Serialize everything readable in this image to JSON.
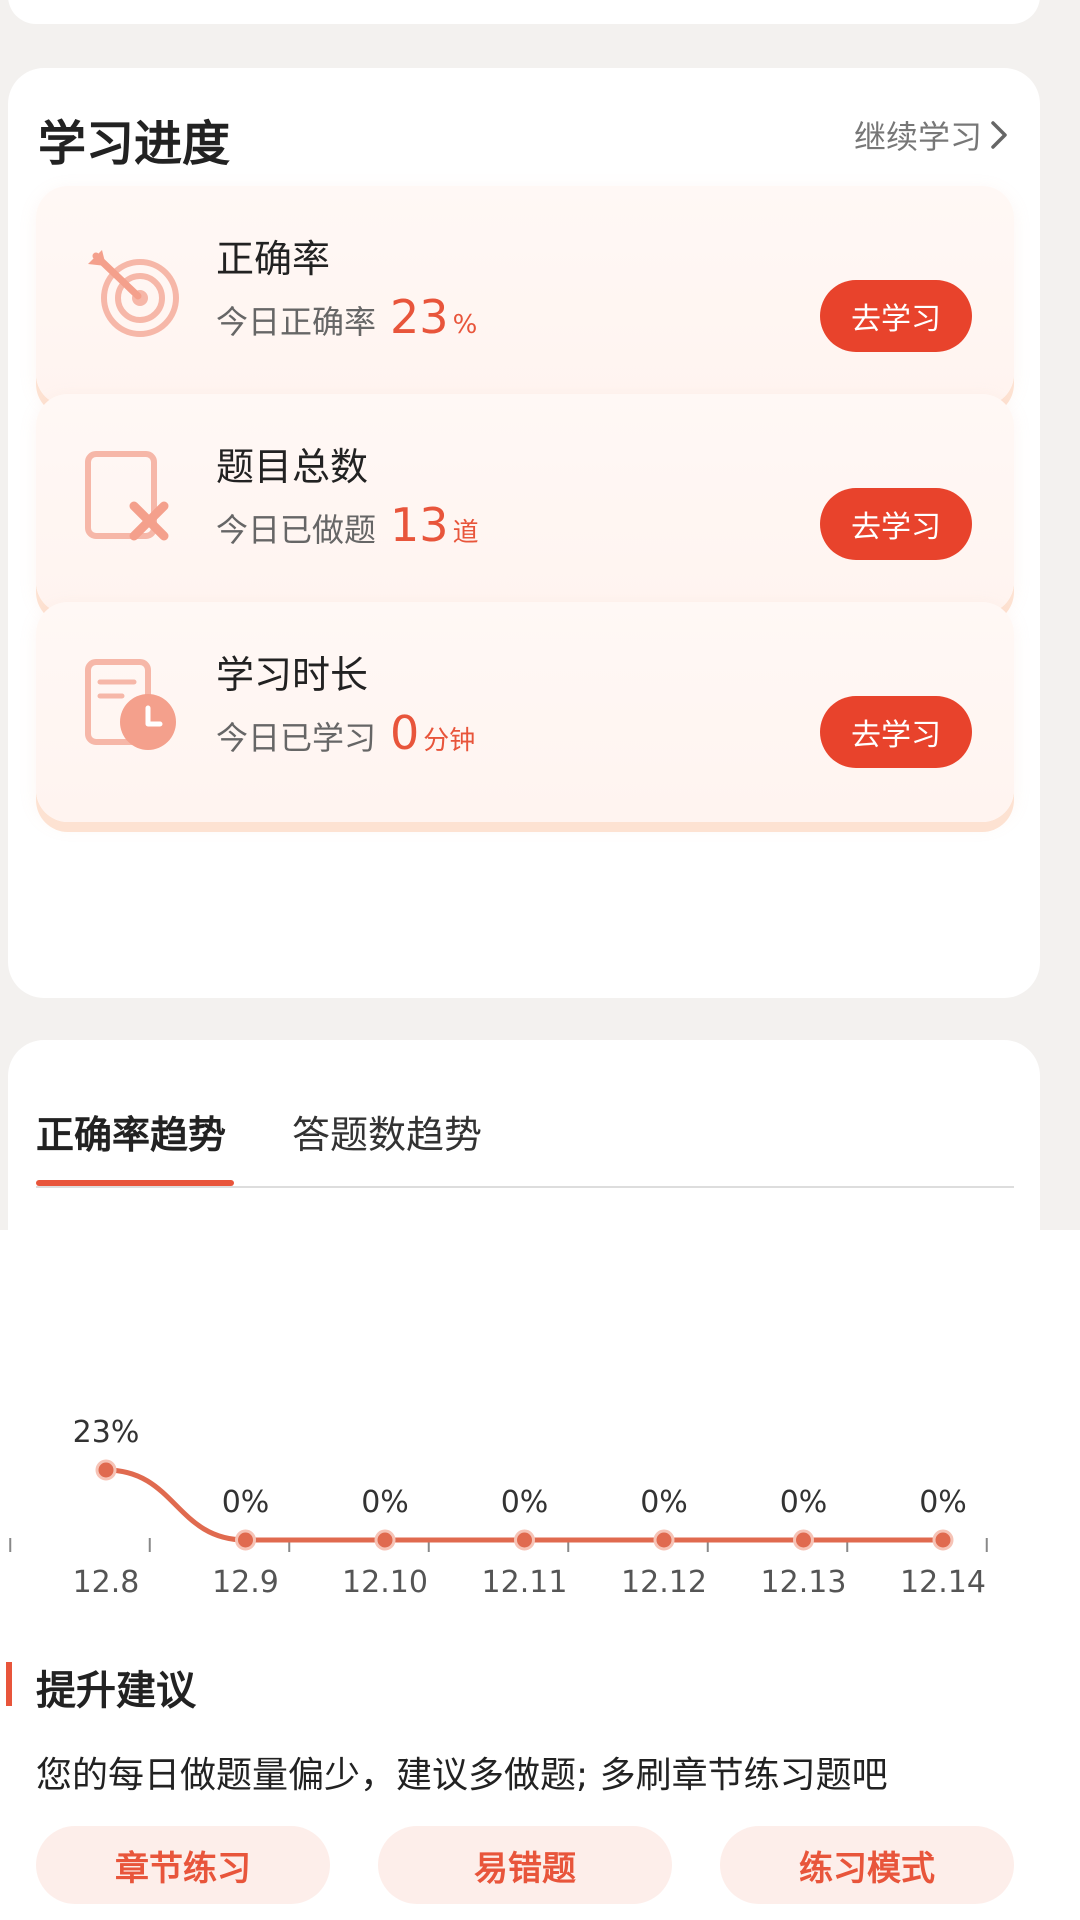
{
  "progress": {
    "title": "学习进度",
    "continue_label": "继续学习",
    "items": [
      {
        "title": "正确率",
        "sub_label": "今日正确率",
        "value": "23",
        "unit": "%",
        "button": "去学习",
        "icon": "target-icon"
      },
      {
        "title": "题目总数",
        "sub_label": "今日已做题",
        "value": "13",
        "unit": "道",
        "button": "去学习",
        "icon": "question-paper-icon"
      },
      {
        "title": "学习时长",
        "sub_label": "今日已学习",
        "value": "0",
        "unit": "分钟",
        "button": "去学习",
        "icon": "study-time-icon"
      }
    ]
  },
  "tabs": [
    {
      "label": "正确率趋势",
      "active": true
    },
    {
      "label": "答题数趋势",
      "active": false
    }
  ],
  "chart_data": {
    "type": "line",
    "title": "",
    "xlabel": "",
    "ylabel": "",
    "x": [
      "12.8",
      "12.9",
      "12.10",
      "12.11",
      "12.12",
      "12.13",
      "12.14"
    ],
    "values": [
      23,
      0,
      0,
      0,
      0,
      0,
      0
    ],
    "data_labels": [
      "23%",
      "0%",
      "0%",
      "0%",
      "0%",
      "0%",
      "0%"
    ],
    "unit": "%",
    "line_color": "#e06a4f",
    "grid": false
  },
  "advice": {
    "title": "提升建议",
    "text": "您的每日做题量偏少，建议多做题; 多刷章节练习题吧",
    "chips": [
      "章节练习",
      "易错题",
      "练习模式"
    ]
  },
  "colors": {
    "accent": "#e8553b",
    "button": "#e8432c",
    "chip_bg": "#fdeeea"
  }
}
